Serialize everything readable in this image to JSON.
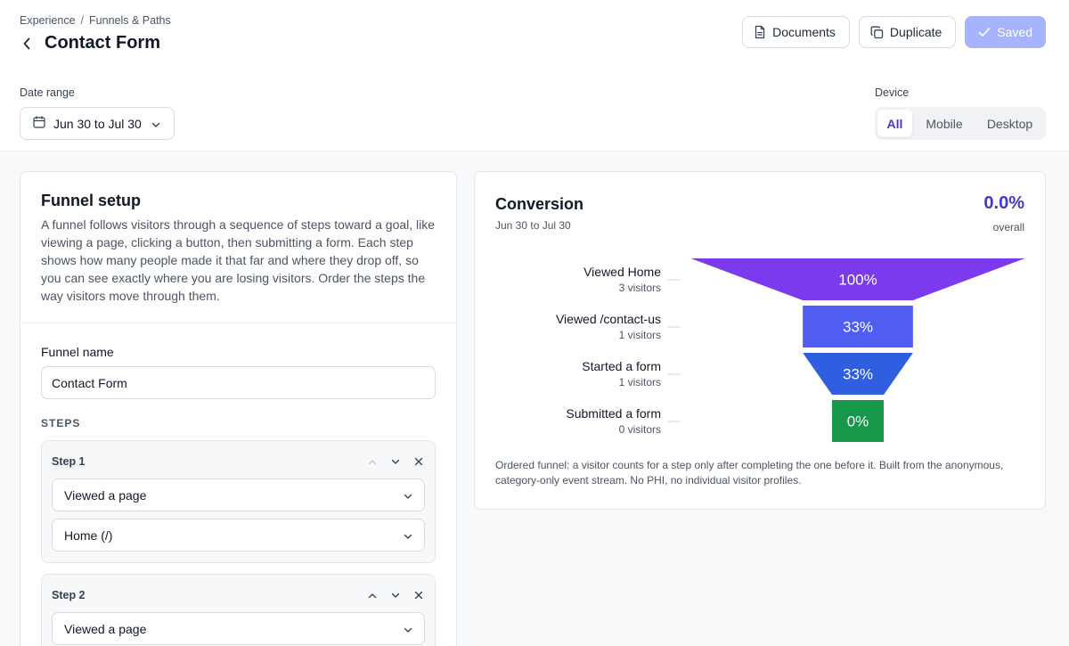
{
  "breadcrumb": {
    "parent": "Experience",
    "separator": "/",
    "current": "Funnels & Paths"
  },
  "page": {
    "title": "Contact Form"
  },
  "actions": {
    "documents": "Documents",
    "duplicate": "Duplicate",
    "saved": "Saved"
  },
  "filters": {
    "date_label": "Date range",
    "date_value": "Jun 30 to Jul 30",
    "device_label": "Device",
    "device_options": [
      "All",
      "Mobile",
      "Desktop"
    ],
    "device_selected": "All"
  },
  "setup": {
    "title": "Funnel setup",
    "description": "A funnel follows visitors through a sequence of steps toward a goal, like viewing a page, clicking a button, then submitting a form. Each step shows how many people made it that far and where they drop off, so you can see exactly where you are losing visitors. Order the steps the way visitors move through them.",
    "name_label": "Funnel name",
    "name_value": "Contact Form",
    "steps_heading": "STEPS",
    "steps": [
      {
        "label": "Step 1",
        "event": "Viewed a page",
        "target": "Home (/)"
      },
      {
        "label": "Step 2",
        "event": "Viewed a page"
      }
    ]
  },
  "conversion": {
    "title": "Conversion",
    "date": "Jun 30 to Jul 30",
    "overall_value": "0.0%",
    "overall_label": "overall",
    "footnote": "Ordered funnel: a visitor counts for a step only after completing the one before it. Built from the anonymous, category-only event stream. No PHI, no individual visitor profiles."
  },
  "chart_data": {
    "type": "bar",
    "categories": [
      "Viewed Home",
      "Viewed /contact-us",
      "Started a form",
      "Submitted a form"
    ],
    "visitors": [
      3,
      1,
      1,
      0
    ],
    "visitor_labels": [
      "3 visitors",
      "1 visitors",
      "1 visitors",
      "0 visitors"
    ],
    "values": [
      100,
      33,
      33,
      0
    ],
    "value_labels": [
      "100%",
      "33%",
      "33%",
      "0%"
    ],
    "colors": [
      "#7c3aed",
      "#4f5ef0",
      "#2f5fe0",
      "#16974a"
    ]
  }
}
